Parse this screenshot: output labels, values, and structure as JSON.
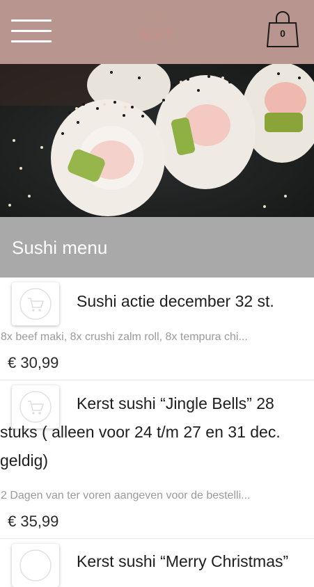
{
  "header": {
    "logo_text": "MET",
    "cart_count": "0"
  },
  "section": {
    "title": "Sushi menu"
  },
  "products": [
    {
      "name": "Sushi actie december 32 st.",
      "description": "8x beef maki, 8x crushi zalm roll, 8x tempura chi...",
      "price": "€ 30,99"
    },
    {
      "name": "Kerst sushi “Jingle Bells” 28 stuks ( alleen voor 24 t/m 27 en 31 dec. geldig)",
      "description": "2 Dagen van ter voren aangeven voor de bestelli...",
      "price": "€ 35,99"
    },
    {
      "name": "Kerst sushi “Merry Christmas”"
    }
  ],
  "colors": {
    "header_bg": "#b8968f",
    "section_bg": "#a9a9a9",
    "logo": "#c98f86"
  },
  "icons": {
    "menu": "hamburger-icon",
    "cart": "shopping-bag-icon",
    "product": "shopping-cart-icon"
  }
}
